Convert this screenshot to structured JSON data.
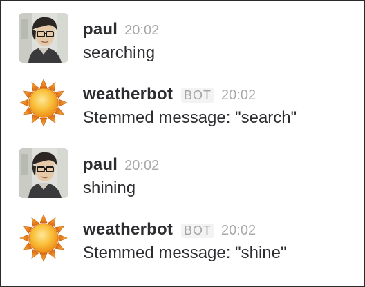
{
  "messages": [
    {
      "author": "paul",
      "time": "20:02",
      "badge": "",
      "text": "searching",
      "avatar_icon": "user-photo-avatar"
    },
    {
      "author": "weatherbot",
      "time": "20:02",
      "badge": "BOT",
      "text": "Stemmed message: \"search\"",
      "avatar_icon": "sun-icon"
    },
    {
      "author": "paul",
      "time": "20:02",
      "badge": "",
      "text": "shining",
      "avatar_icon": "user-photo-avatar"
    },
    {
      "author": "weatherbot",
      "time": "20:02",
      "badge": "BOT",
      "text": "Stemmed message: \"shine\"",
      "avatar_icon": "sun-icon"
    }
  ],
  "colors": {
    "author_text": "#2c2d30",
    "timestamp": "#a8a8a8",
    "bot_badge_text": "#a3a3a3",
    "bot_badge_bg": "#f3f3f3",
    "sun_core": "#f7a51c",
    "sun_rays": "#e8791a"
  }
}
